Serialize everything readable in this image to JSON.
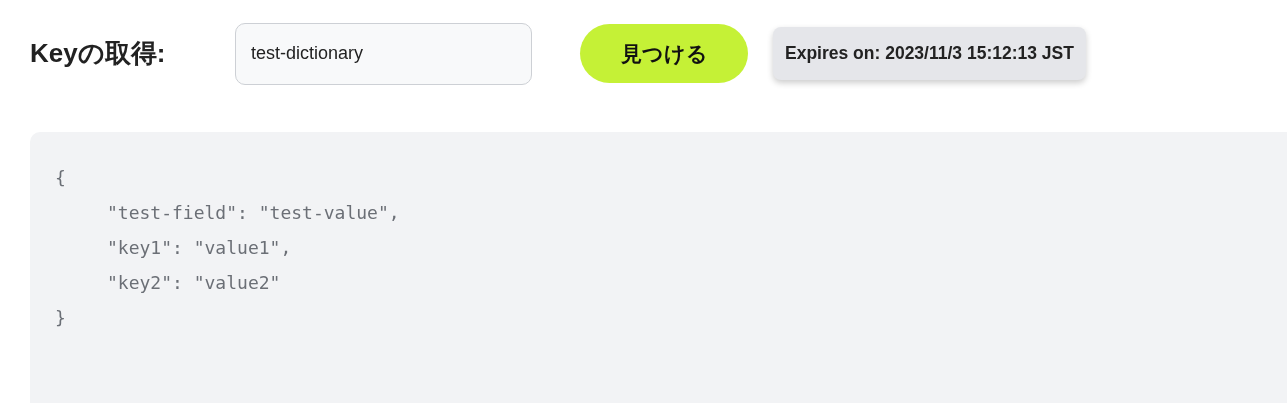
{
  "header": {
    "title": "Keyの取得:",
    "key_field": {
      "value": "test-dictionary"
    },
    "find_button": {
      "label": "見つける"
    },
    "expiry_badge": {
      "text": "Expires on: 2023/11/3 15:12:13 JST"
    }
  },
  "code_block": {
    "lines": [
      {
        "text": "{",
        "children": [
          {
            "text": "\"test-field\": \"test-value\","
          },
          {
            "text": "\"key1\": \"value1\","
          },
          {
            "text": "\"key2\": \"value2\""
          }
        ]
      },
      {
        "text": "}"
      }
    ]
  }
}
